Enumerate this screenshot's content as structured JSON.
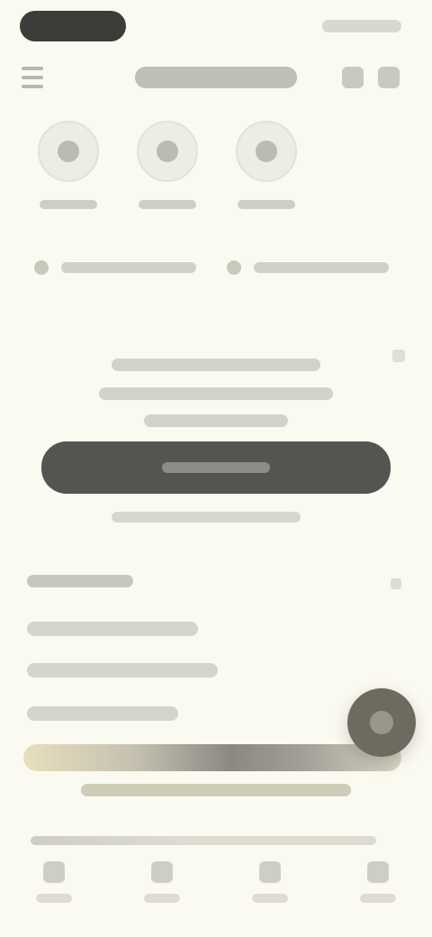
{
  "header": {
    "title": ""
  },
  "quick_actions": [
    {
      "label": "",
      "icon": "circle-icon"
    },
    {
      "label": "",
      "icon": "dot-icon"
    },
    {
      "label": "",
      "icon": "chevron-icon"
    }
  ],
  "chips": [
    {
      "label": "",
      "icon": "tag-icon"
    },
    {
      "label": "",
      "icon": "pin-icon"
    }
  ],
  "card": {
    "headline": "",
    "body": "",
    "primary_button": "",
    "secondary_link": ""
  },
  "section": {
    "title": "",
    "items": [
      "",
      "",
      ""
    ]
  },
  "banner": {
    "text": ""
  },
  "nav": {
    "items": [
      {
        "label": "",
        "icon": "home-icon"
      },
      {
        "label": "",
        "icon": "search-icon"
      },
      {
        "label": "",
        "icon": "bookmark-icon"
      },
      {
        "label": "",
        "icon": "profile-icon"
      }
    ]
  }
}
